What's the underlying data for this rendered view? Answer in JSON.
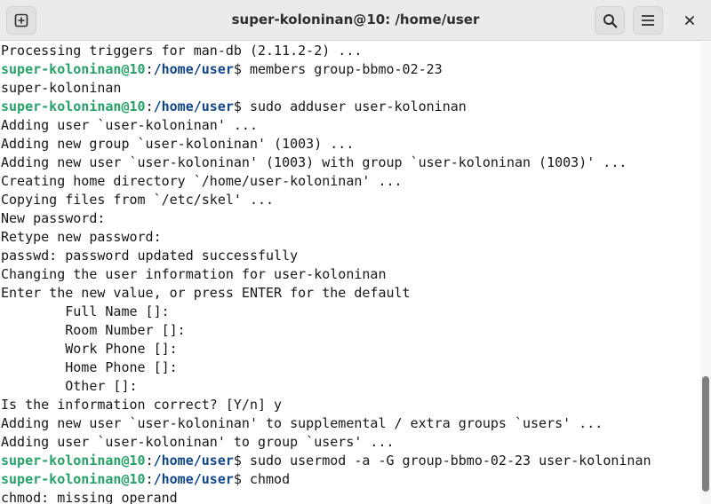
{
  "window": {
    "title": "super-koloninan@10: /home/user"
  },
  "icons": {
    "new_tab": "new-tab-icon",
    "search": "search-icon",
    "menu": "hamburger-menu-icon",
    "close": "close-icon"
  },
  "colors": {
    "prompt_user": "#26a269",
    "prompt_path": "#12488b",
    "text": "#171717"
  },
  "terminal": {
    "lines": [
      {
        "text": "Processing triggers for man-db (2.11.2-2) ..."
      },
      {
        "user": "super-koloninan@10",
        "sep": ":",
        "path": "/home/user",
        "cmd": "$ members group-bbmo-02-23"
      },
      {
        "text": "super-koloninan"
      },
      {
        "user": "super-koloninan@10",
        "sep": ":",
        "path": "/home/user",
        "cmd": "$ sudo adduser user-koloninan"
      },
      {
        "text": "Adding user `user-koloninan' ..."
      },
      {
        "text": "Adding new group `user-koloninan' (1003) ..."
      },
      {
        "text": "Adding new user `user-koloninan' (1003) with group `user-koloninan (1003)' ..."
      },
      {
        "text": "Creating home directory `/home/user-koloninan' ..."
      },
      {
        "text": "Copying files from `/etc/skel' ..."
      },
      {
        "text": "New password:"
      },
      {
        "text": "Retype new password:"
      },
      {
        "text": "passwd: password updated successfully"
      },
      {
        "text": "Changing the user information for user-koloninan"
      },
      {
        "text": "Enter the new value, or press ENTER for the default"
      },
      {
        "text": "        Full Name []:"
      },
      {
        "text": "        Room Number []:"
      },
      {
        "text": "        Work Phone []:"
      },
      {
        "text": "        Home Phone []:"
      },
      {
        "text": "        Other []:"
      },
      {
        "text": "Is the information correct? [Y/n] y"
      },
      {
        "text": "Adding new user `user-koloninan' to supplemental / extra groups `users' ..."
      },
      {
        "text": "Adding user `user-koloninan' to group `users' ..."
      },
      {
        "user": "super-koloninan@10",
        "sep": ":",
        "path": "/home/user",
        "cmd": "$ sudo usermod -a -G group-bbmo-02-23 user-koloninan"
      },
      {
        "user": "super-koloninan@10",
        "sep": ":",
        "path": "/home/user",
        "cmd": "$ chmod"
      },
      {
        "text": "chmod: missing operand"
      }
    ]
  }
}
